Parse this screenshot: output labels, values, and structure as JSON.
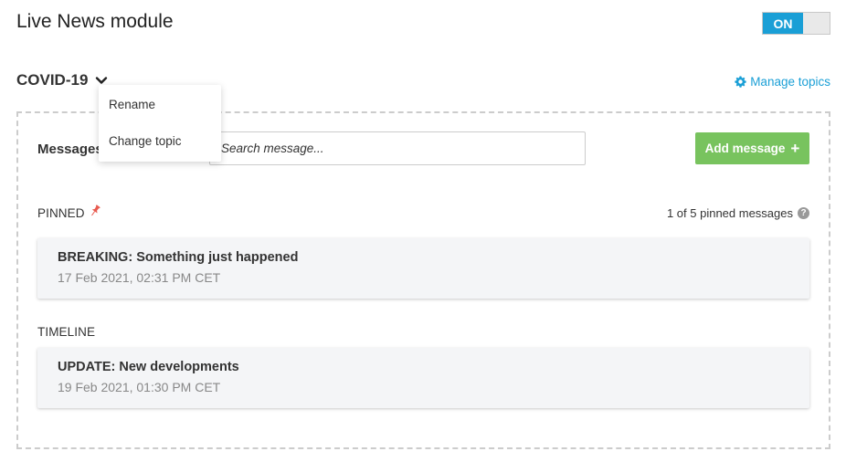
{
  "header": {
    "title": "Live News module",
    "toggle_label": "ON"
  },
  "topic": {
    "name": "COVID-19",
    "manage_label": "Manage topics"
  },
  "dropdown": {
    "items": [
      {
        "label": "Rename"
      },
      {
        "label": "Change topic"
      }
    ]
  },
  "messages": {
    "label": "Messages",
    "search_placeholder": "Search message...",
    "add_label": "Add message"
  },
  "pinned": {
    "label": "PINNED",
    "count_text": "1 of 5 pinned messages",
    "items": [
      {
        "title": "BREAKING: Something just happened",
        "date": "17 Feb 2021, 02:31 PM CET"
      }
    ]
  },
  "timeline": {
    "label": "TIMELINE",
    "items": [
      {
        "title": "UPDATE: New developments",
        "date": "19 Feb 2021, 01:30 PM CET"
      }
    ]
  },
  "colors": {
    "accent": "#1a9fd6",
    "add_button": "#78c35e",
    "pin": "#e85a4f"
  }
}
